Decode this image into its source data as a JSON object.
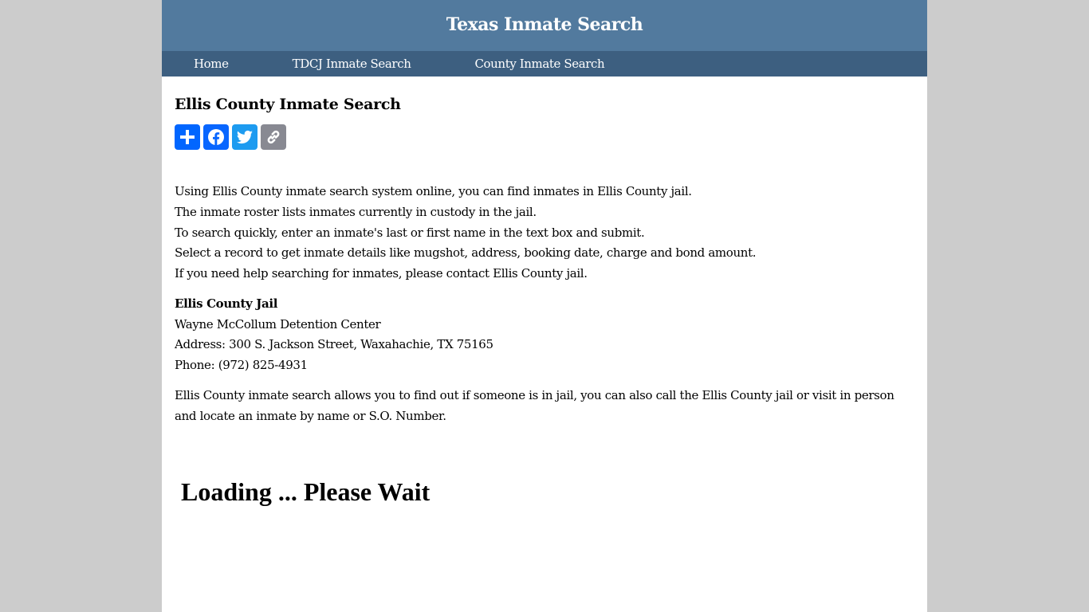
{
  "header": {
    "site_title": "Texas Inmate Search"
  },
  "nav": {
    "items": [
      {
        "label": "Home"
      },
      {
        "label": "TDCJ Inmate Search"
      },
      {
        "label": "County Inmate Search"
      }
    ]
  },
  "main": {
    "page_title": "Ellis County Inmate Search",
    "share_buttons": [
      {
        "name": "share",
        "icon": "plus-icon",
        "color": "#0166ff"
      },
      {
        "name": "facebook",
        "icon": "facebook-icon",
        "color": "#0866ff"
      },
      {
        "name": "twitter",
        "icon": "twitter-icon",
        "color": "#1d9bf0"
      },
      {
        "name": "copy-link",
        "icon": "link-icon",
        "color": "#888992"
      }
    ],
    "intro_lines": [
      "Using Ellis County inmate search system online, you can find inmates in Ellis County jail.",
      "The inmate roster lists inmates currently in custody in the jail.",
      "To search quickly, enter an inmate's last or first name in the text box and submit.",
      "Select a record to get inmate details like mugshot, address, booking date, charge and bond amount.",
      "If you need help searching for inmates, please contact Ellis County jail."
    ],
    "jail": {
      "name": "Ellis County Jail",
      "facility": "Wayne McCollum Detention Center",
      "address": "Address: 300 S. Jackson Street, Waxahachie, TX 75165",
      "phone": "Phone: (972) 825-4931"
    },
    "description": "Ellis County inmate search allows you to find out if someone is in jail, you can also call the Ellis County jail or visit in person and locate an inmate by name or S.O. Number.",
    "loading_text": "Loading ... Please Wait"
  },
  "colors": {
    "page_background": "#cccccc",
    "header_background": "#527a9e",
    "nav_background": "#3d5f80"
  }
}
